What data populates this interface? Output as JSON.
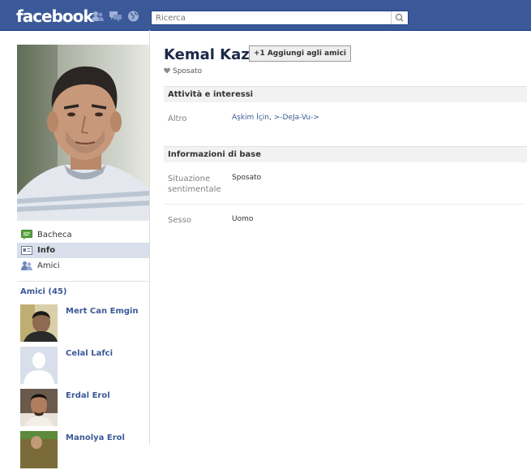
{
  "header": {
    "logo": "facebook",
    "icons": [
      "friend-requests-icon",
      "messages-icon",
      "notifications-globe-icon"
    ],
    "search_placeholder": "Ricerca"
  },
  "sidebar": {
    "nav": [
      {
        "label": "Bacheca",
        "icon": "wall-icon",
        "active": false
      },
      {
        "label": "Info",
        "icon": "info-card-icon",
        "active": true
      },
      {
        "label": "Amici",
        "icon": "friends-icon",
        "active": false
      }
    ],
    "friends_title": "Amici (45)",
    "friends": [
      {
        "name": "Mert Can Emgin"
      },
      {
        "name": "Celal Lafci"
      },
      {
        "name": "Erdal Erol"
      },
      {
        "name": "Manolya Erol"
      }
    ]
  },
  "profile": {
    "name": "Kemal Kaz",
    "add_button": "Aggiungi agli amici",
    "add_button_icon": "+1",
    "status": "Sposato"
  },
  "sections": {
    "activities": {
      "title": "Attività e interessi",
      "other_label": "Altro",
      "other_values": [
        "Aşkim İçin",
        ">-DeJa-Vu->"
      ],
      "other_separator": ", "
    },
    "basic": {
      "title": "Informazioni di base",
      "relationship_label": "Situazione sentimentale",
      "relationship_value": "Sposato",
      "sex_label": "Sesso",
      "sex_value": "Uomo"
    }
  },
  "colors": {
    "brand_blue": "#3b5998",
    "header_border": "#133783",
    "active_nav": "#d8dfea",
    "section_bg": "#f2f2f2"
  }
}
